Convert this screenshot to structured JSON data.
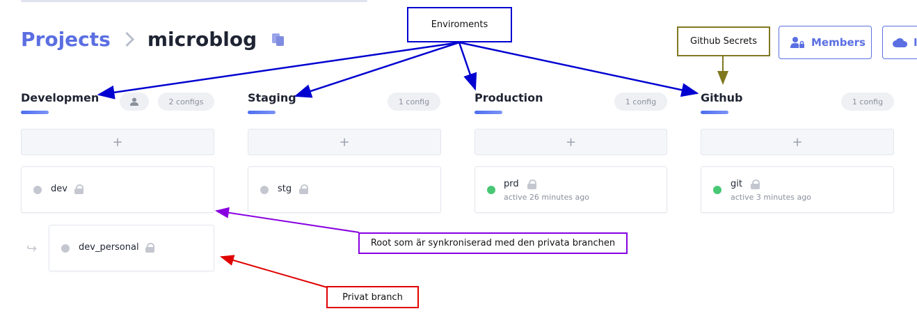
{
  "breadcrumb": {
    "parent": "Projects",
    "current": "microblog"
  },
  "header_buttons": {
    "members_label": "Members",
    "cut_label": "I"
  },
  "environments": [
    {
      "title": "Developmen",
      "count": "2 configs",
      "has_user_pill": true,
      "configs": [
        {
          "name": "dev",
          "status": "gray",
          "subtitle": ""
        },
        {
          "name": "dev_personal",
          "status": "gray",
          "subtitle": "",
          "branch": true
        }
      ]
    },
    {
      "title": "Staging",
      "count": "1 config",
      "configs": [
        {
          "name": "stg",
          "status": "gray",
          "subtitle": ""
        }
      ]
    },
    {
      "title": "Production",
      "count": "1 config",
      "configs": [
        {
          "name": "prd",
          "status": "green",
          "subtitle": "active 26 minutes ago"
        }
      ]
    },
    {
      "title": "Github",
      "count": "1 config",
      "configs": [
        {
          "name": "git",
          "status": "green",
          "subtitle": "active 3 minutes ago"
        }
      ]
    }
  ],
  "add_symbol": "+",
  "branch_arrow": "↪",
  "annotations": {
    "enviroments": "Enviroments",
    "github_secrets": "Github Secrets",
    "root_synced": "Root som är synkroniserad med den privata branchen",
    "private_branch": "Privat branch"
  },
  "annotation_colors": {
    "blue": "#0000d0",
    "olive": "#807820",
    "purple": "#8800e0",
    "red": "#e00000"
  },
  "accent_color": "#5b6fe2"
}
